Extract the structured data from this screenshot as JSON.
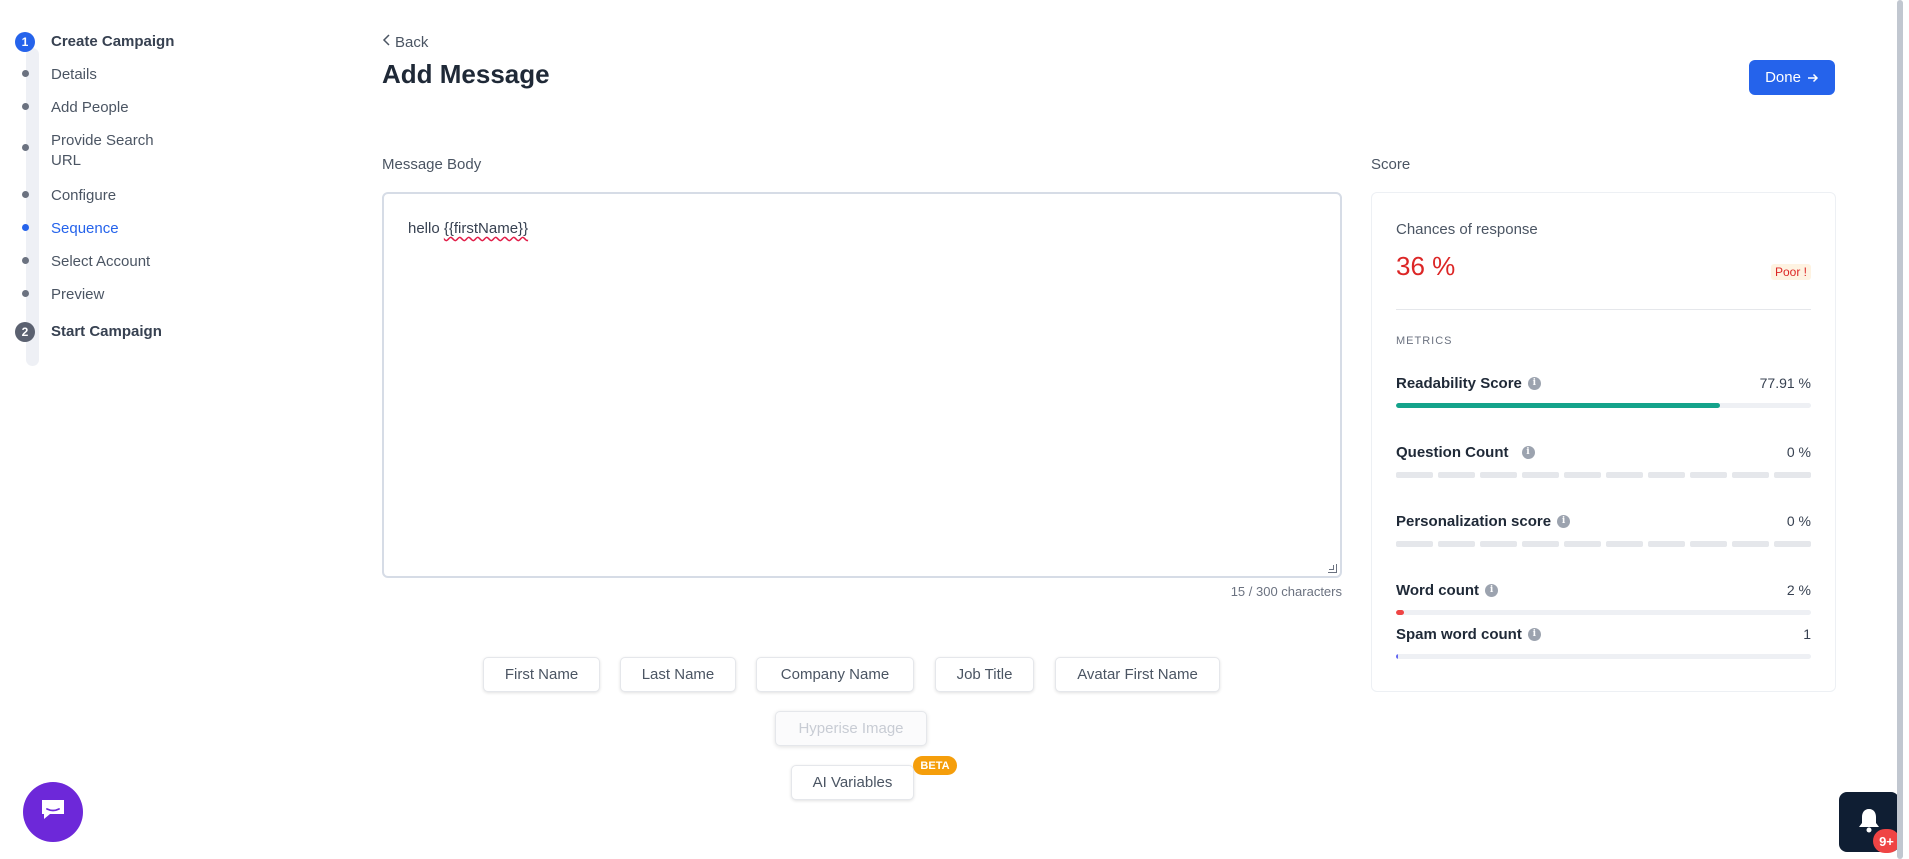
{
  "stepper": {
    "steps": [
      {
        "number": "1",
        "title": "Create Campaign"
      },
      {
        "number": "2",
        "title": "Start Campaign"
      }
    ],
    "substeps": [
      {
        "label": "Details"
      },
      {
        "label": "Add People"
      },
      {
        "label": "Provide Search URL"
      },
      {
        "label": "Configure"
      },
      {
        "label": "Sequence",
        "active": true
      },
      {
        "label": "Select Account"
      },
      {
        "label": "Preview"
      }
    ]
  },
  "header": {
    "back_label": "Back",
    "title": "Add Message",
    "done_label": "Done",
    "done_icon": "arrow-right-icon"
  },
  "message": {
    "section_label": "Message Body",
    "text_prefix": "hello ",
    "text_variable": "{{firstName}}",
    "char_count": "15 / 300 characters"
  },
  "variables": {
    "chips": [
      "First Name",
      "Last Name",
      "Company Name",
      "Job Title",
      "Avatar First Name"
    ],
    "hyperise_label": "Hyperise Image",
    "ai_label": "AI Variables",
    "beta_label": "BETA"
  },
  "score": {
    "section_label": "Score",
    "chances_label": "Chances of response",
    "chances_value": "36 %",
    "rating": "Poor !",
    "metrics_label": "METRICS",
    "metrics": [
      {
        "name": "Readability Score",
        "value": "77.91 %",
        "level": 0.78,
        "style": "bar",
        "color": "#14a38b"
      },
      {
        "name": "Question Count",
        "value": "0 %",
        "level": 0,
        "style": "segments"
      },
      {
        "name": "Personalization score",
        "value": "0 %",
        "level": 0,
        "style": "segments"
      },
      {
        "name": "Word count",
        "value": "2 %",
        "level": 0.02,
        "style": "bar",
        "color": "#ef4444"
      },
      {
        "name": "Spam word count",
        "value": "1",
        "level": 0.005,
        "style": "bar",
        "color": "#6366f1"
      }
    ]
  },
  "widgets": {
    "chat_icon": "chat-icon",
    "bell_icon": "bell-icon",
    "notification_badge": "9+"
  },
  "colors": {
    "accent": "#2563eb",
    "danger": "#dc2626",
    "chat": "#6d28d9",
    "beta": "#f59e0b"
  }
}
